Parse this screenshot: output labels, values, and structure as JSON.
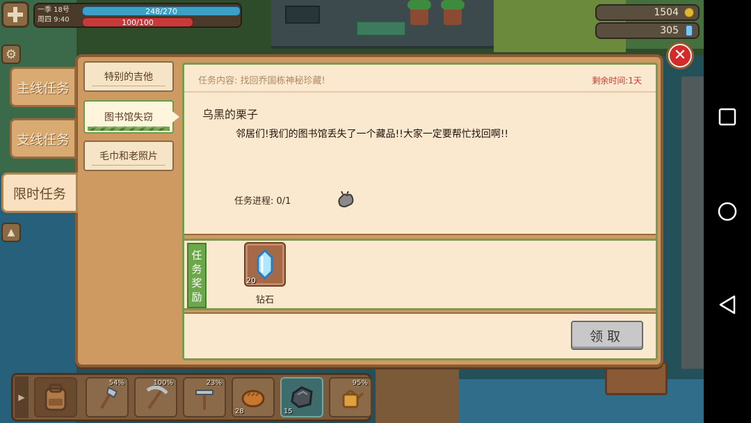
{
  "hud": {
    "season_day": "一季  18号",
    "weekday_time": "周四  9:40",
    "energy": "248/270",
    "health": "100/100",
    "gold": "1504",
    "gems": "305"
  },
  "quest_window": {
    "category_tabs": [
      {
        "label": "主线任务",
        "active": false
      },
      {
        "label": "支线任务",
        "active": false
      },
      {
        "label": "限时任务",
        "active": true
      }
    ],
    "quest_list": [
      {
        "label": "特别的吉他",
        "active": false
      },
      {
        "label": "图书馆失窃",
        "active": true
      },
      {
        "label": "毛巾和老照片",
        "active": false
      }
    ],
    "detail": {
      "content_label": "任务内容:   找回乔国栋神秘珍藏!",
      "time_left": "剩余时间:1天",
      "title": "乌黑的栗子",
      "description": "邻居们!我们的图书馆丢失了一个藏品!!大家一定要帮忙找回啊!!",
      "progress": "任务进程:   0/1",
      "reward_label": "任务奖励",
      "reward": {
        "name": "钻石",
        "count": "20"
      },
      "claim_button": "领取"
    }
  },
  "hotbar": {
    "slots": [
      {
        "item": "axe-icon",
        "pct": "54%",
        "count": ""
      },
      {
        "item": "pickaxe-icon",
        "pct": "100%",
        "count": ""
      },
      {
        "item": "hoe-icon",
        "pct": "23%",
        "count": ""
      },
      {
        "item": "bread-icon",
        "pct": "",
        "count": "28"
      },
      {
        "item": "ore-icon",
        "pct": "",
        "count": "15"
      },
      {
        "item": "watering-can-icon",
        "pct": "95%",
        "count": ""
      }
    ]
  },
  "colors": {
    "panel": "#cf9a62",
    "panel_border": "#8a5a32",
    "inner_bg": "#fbe9cf",
    "accent_green": "#6aa84a",
    "time_red": "#d2322a"
  }
}
